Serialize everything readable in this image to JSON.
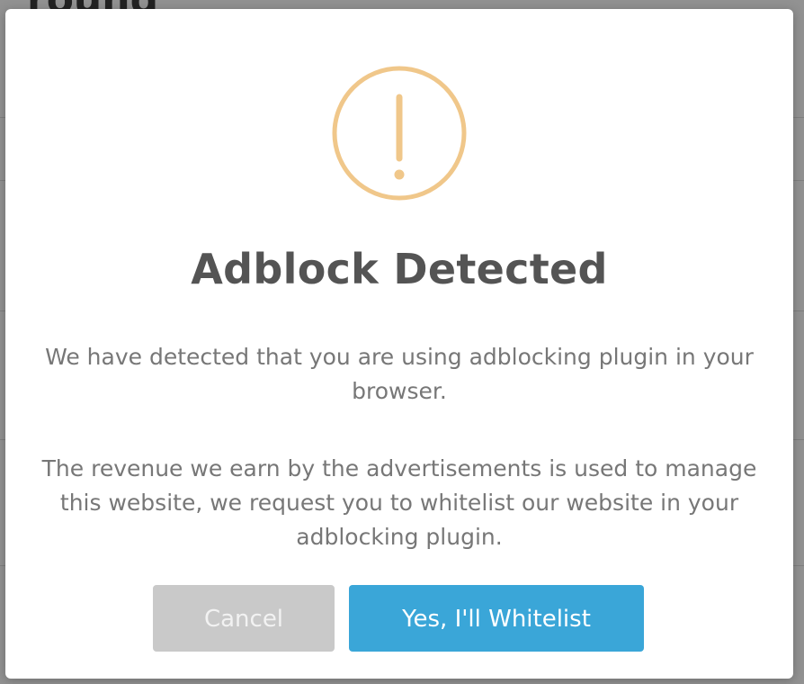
{
  "background": {
    "heading_fragment": "round"
  },
  "modal": {
    "icon": "exclamation-circle-icon",
    "icon_color": "#f0c78a",
    "title": "Adblock Detected",
    "message_1": "We have detected that you are using adblocking plugin in your browser.",
    "message_2": "The revenue we earn by the advertisements is used to manage this website, we request you to whitelist our website in your adblocking plugin.",
    "cancel_label": "Cancel",
    "confirm_label": "Yes, I'll Whitelist",
    "confirm_color": "#3aa6d8",
    "cancel_color": "#c9c9c9"
  }
}
